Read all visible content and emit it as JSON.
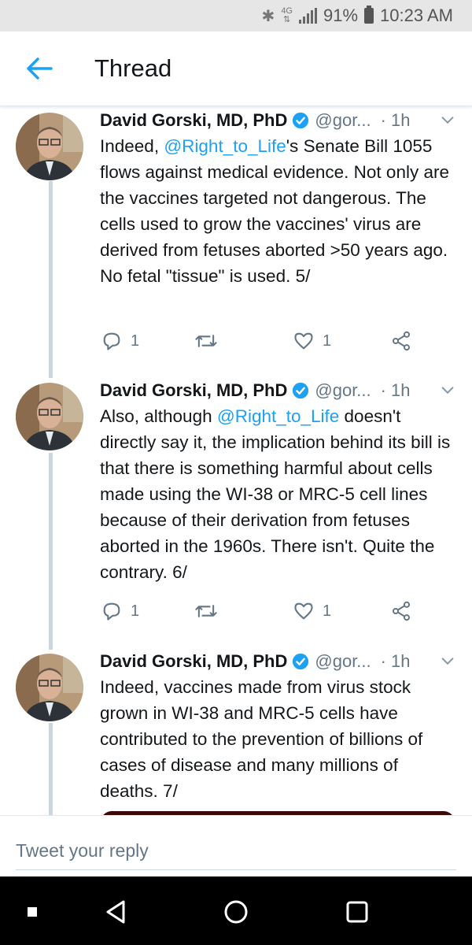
{
  "status_bar": {
    "network": "4G",
    "battery": "91%",
    "time": "10:23 AM"
  },
  "header": {
    "title": "Thread"
  },
  "tweets": [
    {
      "name": "David Gorski, MD, PhD",
      "handle": "@gor...",
      "separator": "·",
      "time": "1h",
      "text_parts": [
        "Indeed, ",
        "@Right_to_Life",
        "'s Senate Bill 1055 flows against medical evidence. Not only are the vaccines targeted not dangerous. The cells used to grow the vaccines' virus are derived from fetuses aborted >50 years ago. No fetal \"tissue\" is used. 5/"
      ],
      "replies": "1",
      "likes": "1"
    },
    {
      "name": "David Gorski, MD, PhD",
      "handle": "@gor...",
      "separator": "·",
      "time": "1h",
      "text_parts": [
        "Also, although ",
        "@Right_to_Life",
        " doesn't directly say it, the implication behind its bill is that there is something harmful about cells made using the WI-38 or MRC-5 cell lines because of their derivation from fetuses aborted in the 1960s. There isn't. Quite the contrary. 6/"
      ],
      "replies": "1",
      "likes": "1"
    },
    {
      "name": "David Gorski, MD, PhD",
      "handle": "@gor...",
      "separator": "·",
      "time": "1h",
      "text_parts": [
        "Indeed, vaccines made from virus stock grown in WI-38 and MRC-5 cells have contributed to the prevention of billions of cases of disease and many millions of deaths. 7/"
      ]
    }
  ],
  "reply_bar": {
    "placeholder": "Tweet your reply"
  },
  "colors": {
    "accent": "#1da1f2",
    "text": "#14171a",
    "muted": "#657786"
  }
}
